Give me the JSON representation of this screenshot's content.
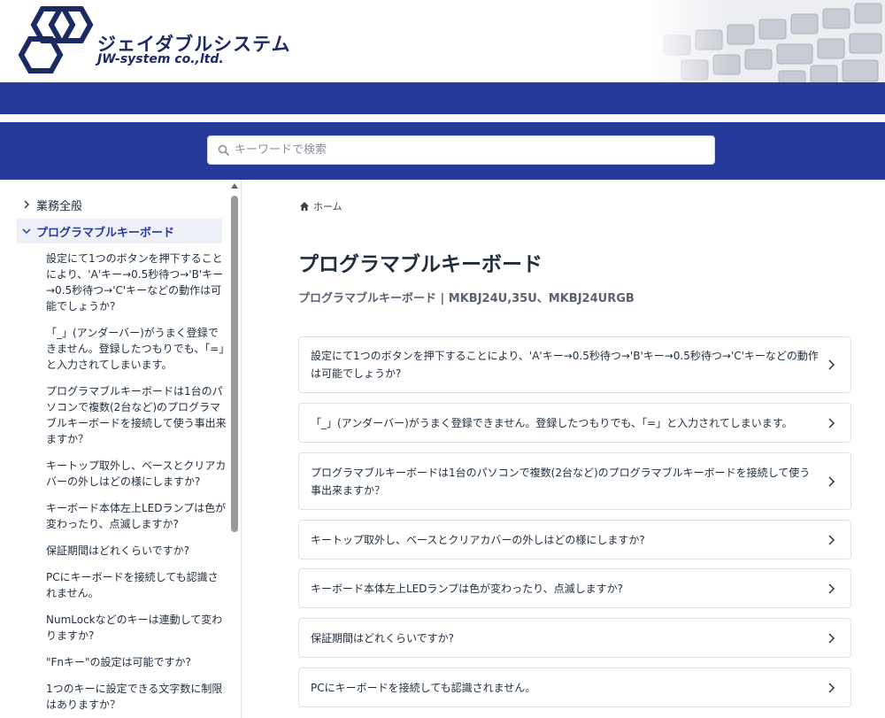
{
  "header": {
    "logo_name": "ジェイダブルシステム",
    "logo_sub": "JW-system co.,ltd."
  },
  "search": {
    "placeholder": "キーワードで検索"
  },
  "sidebar": {
    "categories": [
      {
        "label": "業務全般",
        "expanded": false
      },
      {
        "label": "プログラマブルキーボード",
        "expanded": true
      }
    ],
    "items": [
      "設定にて1つのボタンを押下することにより、'A'キー→0.5秒待つ→'B'キー→0.5秒待つ→'C'キーなどの動作は可能でしょうか?",
      "「_」(アンダーバー)がうまく登録できません。登録したつもりでも、「=」と入力されてしまいます。",
      "プログラマブルキーボードは1台のパソコンで複数(2台など)のプログラマブルキーボードを接続して使う事出来ますか？",
      "キートップ取外し、ベースとクリアカバーの外しはどの様にしますか?",
      "キーボード本体左上LEDランプは色が変わったり、点滅しますか?",
      "保証期間はどれくらいですか?",
      "PCにキーボードを接続しても認識されません。",
      "NumLockなどのキーは連動して変わりますか?",
      "\"Fnキー\"の設定は可能ですか?",
      "1つのキーに設定できる文字数に制限はありますか？"
    ]
  },
  "main": {
    "breadcrumb_home": "ホーム",
    "title": "プログラマブルキーボード",
    "description": "プログラマブルキーボード | MKBJ24U,35U、MKBJ24URGB",
    "articles": [
      "設定にて1つのボタンを押下することにより、'A'キー→0.5秒待つ→'B'キー→0.5秒待つ→'C'キーなどの動作は可能でしょうか?",
      "「_」(アンダーバー)がうまく登録できません。登録したつもりでも、「=」と入力されてしまいます。",
      "プログラマブルキーボードは1台のパソコンで複数(2台など)のプログラマブルキーボードを接続して使う事出来ますか？",
      "キートップ取外し、ベースとクリアカバーの外しはどの様にしますか?",
      "キーボード本体左上LEDランプは色が変わったり、点滅しますか?",
      "保証期間はどれくらいですか?",
      "PCにキーボードを接続しても認識されません。"
    ]
  },
  "colors": {
    "brand_blue": "#263b99",
    "logo_navy": "#1c2a63"
  },
  "icons": [
    "logo-icon",
    "keyboard-image",
    "search-icon",
    "chevron-right-icon",
    "chevron-down-icon",
    "home-icon"
  ]
}
